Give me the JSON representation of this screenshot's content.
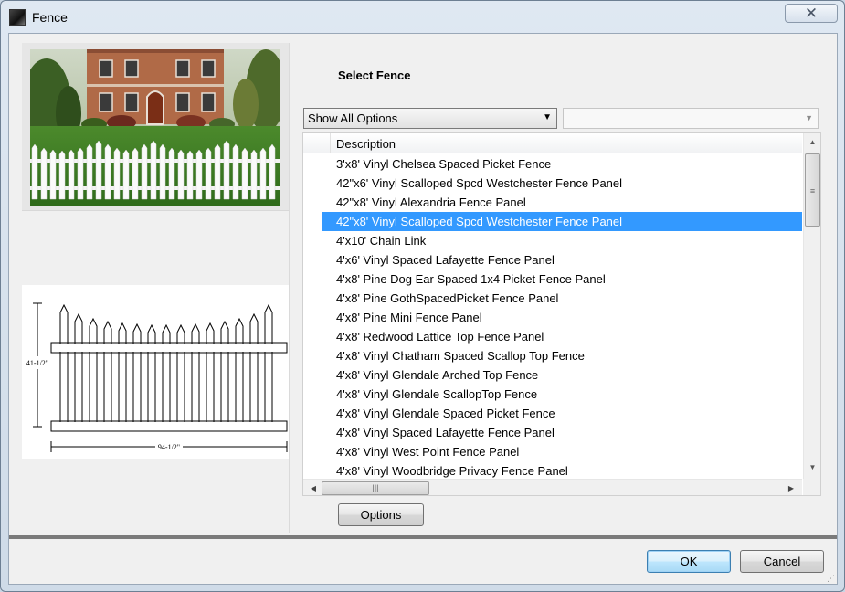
{
  "window": {
    "title": "Fence",
    "close_symbol": "✕",
    "icon": "fence-app-icon"
  },
  "header": {
    "select_title": "Select Fence"
  },
  "filter": {
    "selected": "Show All Options",
    "secondary_selected": ""
  },
  "table": {
    "column_header": "Description",
    "selected_index": 3,
    "rows": [
      "3'x8' Vinyl Chelsea Spaced Picket Fence",
      "42\"x6' Vinyl Scalloped Spcd Westchester Fence Panel",
      "42\"x8' Vinyl Alexandria Fence Panel",
      "42\"x8' Vinyl Scalloped Spcd Westchester Fence Panel",
      "4'x10' Chain Link",
      "4'x6' Vinyl Spaced Lafayette Fence Panel",
      "4'x8' Pine Dog Ear Spaced 1x4 Picket Fence Panel",
      "4'x8' Pine GothSpacedPicket Fence Panel",
      "4'x8' Pine Mini Fence Panel",
      "4'x8' Redwood Lattice Top Fence Panel",
      "4'x8' Vinyl Chatham Spaced Scallop Top Fence",
      "4'x8' Vinyl Glendale Arched Top Fence",
      "4'x8' Vinyl Glendale ScallopTop Fence",
      "4'x8' Vinyl Glendale Spaced Picket Fence",
      "4'x8' Vinyl Spaced Lafayette Fence Panel",
      "4'x8' Vinyl West Point Fence Panel",
      "4'x8' Vinyl Woodbridge Privacy Fence Panel"
    ]
  },
  "drawing": {
    "height_label": "41-1/2\"",
    "width_label": "94-1/2\""
  },
  "buttons": {
    "options": "Options",
    "ok": "OK",
    "cancel": "Cancel"
  },
  "colors": {
    "selection": "#3399ff",
    "window_frame": "#cfdbe8"
  }
}
